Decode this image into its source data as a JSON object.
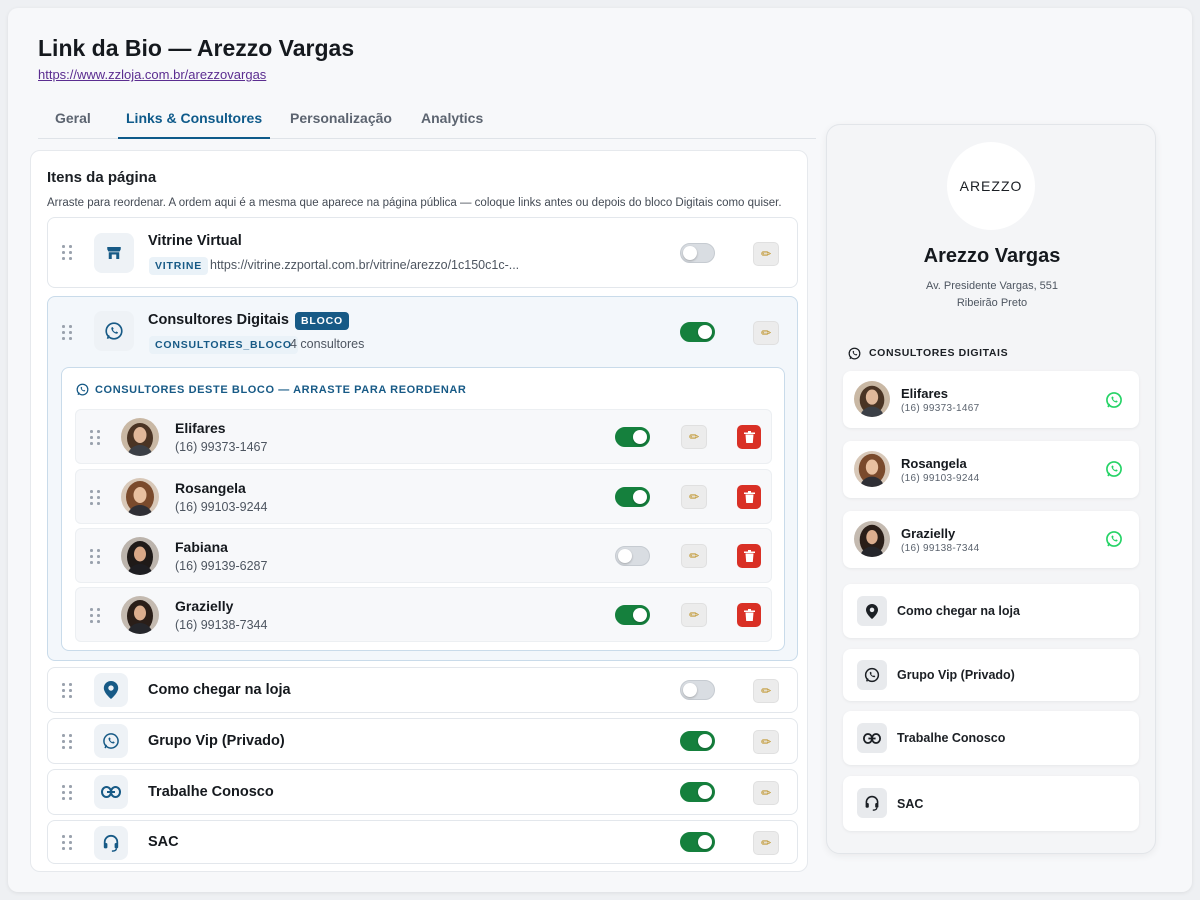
{
  "header": {
    "title": "Link da Bio — Arezzo Vargas",
    "url": "https://www.zzloja.com.br/arezzovargas"
  },
  "tabs": [
    {
      "label": "Geral"
    },
    {
      "label": "Links & Consultores",
      "active": true
    },
    {
      "label": "Personalização"
    },
    {
      "label": "Analytics"
    }
  ],
  "main": {
    "title": "Itens da página",
    "subtitle": "Arraste para reordenar. A ordem aqui é a mesma que aparece na página pública — coloque links antes ou depois do bloco Digitais como quiser."
  },
  "items": {
    "vitrine": {
      "title": "Vitrine Virtual",
      "tag": "VITRINE",
      "url": "https://vitrine.zzportal.com.br/vitrine/arezzo/1c150c1c-...",
      "enabled": false,
      "icon": "store-icon"
    },
    "consultores": {
      "title": "Consultores Digitais",
      "badge": "BLOCO",
      "tag": "CONSULTORES_BLOCO",
      "count": "4 consultores",
      "enabled": true,
      "icon": "whatsapp-icon"
    },
    "chegar": {
      "title": "Como chegar na loja",
      "enabled": false,
      "icon": "location-pin-icon"
    },
    "grupo": {
      "title": "Grupo Vip (Privado)",
      "enabled": true,
      "icon": "whatsapp-icon"
    },
    "trabalhe": {
      "title": "Trabalhe Conosco",
      "enabled": true,
      "icon": "link-icon"
    },
    "sac": {
      "title": "SAC",
      "enabled": true,
      "icon": "headset-icon"
    }
  },
  "block": {
    "title": "CONSULTORES DESTE BLOCO — ARRASTE PARA REORDENAR",
    "consultants": [
      {
        "name": "Elifares",
        "phone": "(16) 99373-1467",
        "enabled": true
      },
      {
        "name": "Rosangela",
        "phone": "(16) 99103-9244",
        "enabled": true
      },
      {
        "name": "Fabiana",
        "phone": "(16) 99139-6287",
        "enabled": false
      },
      {
        "name": "Grazielly",
        "phone": "(16) 99138-7344",
        "enabled": true
      }
    ]
  },
  "preview": {
    "logo": "AREZZO",
    "name": "Arezzo Vargas",
    "address_line1": "Av. Presidente Vargas, 551",
    "address_line2": "Ribeirão Preto",
    "section": "CONSULTORES DIGITAIS",
    "consultants": [
      {
        "name": "Elifares",
        "phone": "(16) 99373-1467"
      },
      {
        "name": "Rosangela",
        "phone": "(16) 99103-9244"
      },
      {
        "name": "Grazielly",
        "phone": "(16) 99138-7344"
      }
    ],
    "links": [
      {
        "label": "Como chegar na loja",
        "icon": "location-pin-icon"
      },
      {
        "label": "Grupo Vip (Privado)",
        "icon": "whatsapp-icon"
      },
      {
        "label": "Trabalhe Conosco",
        "icon": "link-icon"
      },
      {
        "label": "SAC",
        "icon": "headset-icon"
      }
    ]
  },
  "colors": {
    "accent": "#0e5a8a",
    "toggle_on": "#15803d",
    "delete": "#d93025",
    "whatsapp": "#25d366"
  }
}
